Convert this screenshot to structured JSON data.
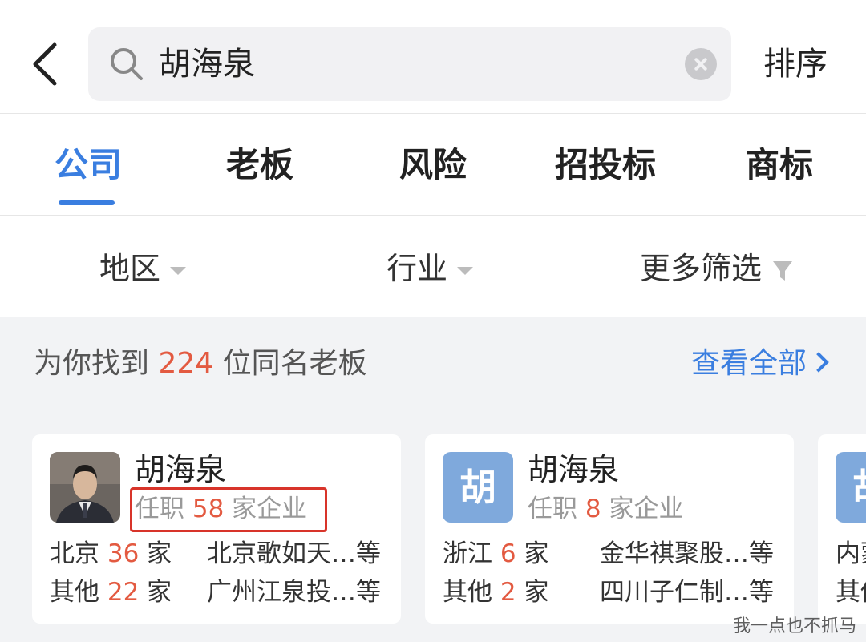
{
  "header": {
    "search_value": "胡海泉",
    "sort_label": "排序"
  },
  "tabs": [
    {
      "label": "公司",
      "active": true
    },
    {
      "label": "老板",
      "active": false
    },
    {
      "label": "风险",
      "active": false
    },
    {
      "label": "招投标",
      "active": false
    },
    {
      "label": "商标",
      "active": false
    }
  ],
  "filters": {
    "region": "地区",
    "industry": "行业",
    "more": "更多筛选"
  },
  "banner": {
    "prefix": "为你找到",
    "count": "224",
    "suffix": "位同名老板",
    "view_all": "查看全部"
  },
  "cards": [
    {
      "name": "胡海泉",
      "sub_prefix": "任职",
      "sub_count": "58",
      "sub_suffix": "家企业",
      "rows": [
        {
          "region": "北京",
          "count": "36",
          "unit": "家",
          "company": "北京歌如天…等"
        },
        {
          "region": "其他",
          "count": "22",
          "unit": "家",
          "company": "广州江泉投…等"
        }
      ]
    },
    {
      "name": "胡海泉",
      "avatar_letter": "胡",
      "sub_prefix": "任职",
      "sub_count": "8",
      "sub_suffix": "家企业",
      "rows": [
        {
          "region": "浙江",
          "count": "6",
          "unit": "家",
          "company": "金华祺聚股…等"
        },
        {
          "region": "其他",
          "count": "2",
          "unit": "家",
          "company": "四川子仁制…等"
        }
      ]
    },
    {
      "avatar_letter": "胡",
      "rows": [
        {
          "region": "内蒙"
        },
        {
          "region": "其他"
        }
      ]
    }
  ],
  "colors": {
    "accent": "#3a7ee0",
    "count_red": "#e35a41",
    "highlight_red": "#d8342a"
  },
  "watermark": "我一点也不抓马"
}
